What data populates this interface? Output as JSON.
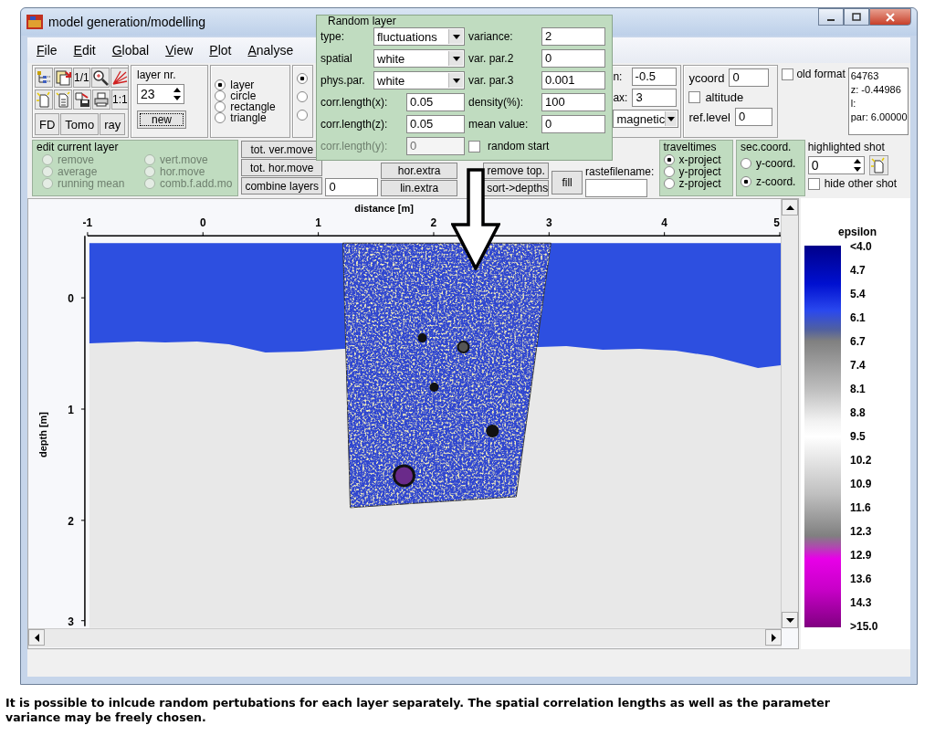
{
  "window": {
    "title": "model generation/modelling"
  },
  "menu": [
    "File",
    "Edit",
    "Global",
    "View",
    "Plot",
    "Analyse"
  ],
  "toolbar": {
    "fit_button": "1/1",
    "scale_button": "1:1",
    "mode_buttons": [
      "FD",
      "Tomo",
      "ray"
    ],
    "layer_nr": {
      "label": "layer nr.",
      "value": "23"
    },
    "new_button": "new",
    "shape_options": [
      {
        "label": "layer",
        "selected": true
      },
      {
        "label": "circle",
        "selected": false
      },
      {
        "label": "rectangle",
        "selected": false
      },
      {
        "label": "triangle",
        "selected": false
      }
    ],
    "draw_options": [
      {
        "selected": true
      },
      {
        "selected": false
      },
      {
        "selected": false
      }
    ],
    "range": {
      "min_label": "n:",
      "min_value": "-0.5",
      "max_label": "ax:",
      "max_value": "3"
    },
    "parameter_dropdown": "magnetic",
    "ycoord": {
      "label": "ycoord",
      "value": "0"
    },
    "altitude": {
      "label": "altitude",
      "checked": false
    },
    "ref_level": {
      "label": "ref.level",
      "value": "0"
    },
    "old_format": {
      "label": "old format",
      "checked": false
    },
    "info_lines": [
      "64763",
      "z: -0.44986",
      "l:",
      "par: 6.00000"
    ]
  },
  "edit_current_layer": {
    "title": "edit current layer",
    "options": [
      {
        "label": "remove",
        "selected": false,
        "disabled": true
      },
      {
        "label": "average",
        "selected": false,
        "disabled": true
      },
      {
        "label": "running mean",
        "selected": false,
        "disabled": true
      },
      {
        "label": "vert.move",
        "selected": false,
        "disabled": true
      },
      {
        "label": "hor.move",
        "selected": false,
        "disabled": true
      },
      {
        "label": "comb.f.add.mo",
        "selected": false,
        "disabled": true
      }
    ]
  },
  "layer_buttons": [
    "tot. ver.move",
    "tot. hor.move",
    "combine layers"
  ],
  "move_value": "0",
  "extrapolation_buttons": [
    "hor.extra",
    "remove top.",
    "lin.extra",
    "sort->depths"
  ],
  "fill_button": "fill",
  "rastefilename": {
    "label": "rastefilename:"
  },
  "traveltimes": {
    "title": "traveltimes",
    "options": [
      {
        "label": "x-project",
        "selected": true
      },
      {
        "label": "y-project",
        "selected": false
      },
      {
        "label": "z-project",
        "selected": false
      }
    ]
  },
  "sec_coord": {
    "title": "sec.coord.",
    "options": [
      {
        "label": "y-coord.",
        "selected": false
      },
      {
        "label": "z-coord.",
        "selected": true
      }
    ]
  },
  "highlighted_shot": {
    "title": "highlighted shot",
    "value": "0",
    "hide_other_shots": {
      "label": "hide other shot",
      "checked": false
    }
  },
  "random_layer": {
    "title": "Random layer",
    "left_fields": [
      {
        "kind": "dropdown",
        "label": "type:",
        "value": "fluctuations",
        "disabled": false
      },
      {
        "kind": "dropdown",
        "label": "spatial",
        "value": "white",
        "disabled": false
      },
      {
        "kind": "dropdown",
        "label": "phys.par.",
        "value": "white",
        "disabled": false
      },
      {
        "kind": "input",
        "label": "corr.length(x):",
        "value": "0.05",
        "disabled": false
      },
      {
        "kind": "input",
        "label": "corr.length(z):",
        "value": "0.05",
        "disabled": false
      },
      {
        "kind": "input",
        "label": "corr.length(y):",
        "value": "0",
        "disabled": true
      }
    ],
    "right_fields": [
      {
        "label": "variance:",
        "value": "2"
      },
      {
        "label": "var. par.2",
        "value": "0"
      },
      {
        "label": "var. par.3",
        "value": "0.001"
      },
      {
        "label": "density(%):",
        "value": "100"
      },
      {
        "label": "mean value:",
        "value": "0"
      }
    ],
    "random_start": {
      "label": "random start",
      "checked": false
    }
  },
  "plot": {
    "x_axis": {
      "label": "distance [m]",
      "ticks": [
        "-1",
        "0",
        "1",
        "2",
        "3",
        "4",
        "5"
      ]
    },
    "y_axis": {
      "label": "depth [m]",
      "ticks": [
        "0",
        "1",
        "2",
        "3"
      ]
    }
  },
  "colorbar": {
    "title": "epsilon",
    "labels": [
      "<4.0",
      "4.7",
      "5.4",
      "6.1",
      "6.7",
      "7.4",
      "8.1",
      "8.8",
      "9.5",
      "10.2",
      "10.9",
      "11.6",
      "12.3",
      "12.9",
      "13.6",
      "14.3",
      ">15.0"
    ]
  },
  "caption": "It is possible to inlcude random pertubations for each layer separately. The spatial correlation lengths as well as the parameter variance may be freely chosen."
}
